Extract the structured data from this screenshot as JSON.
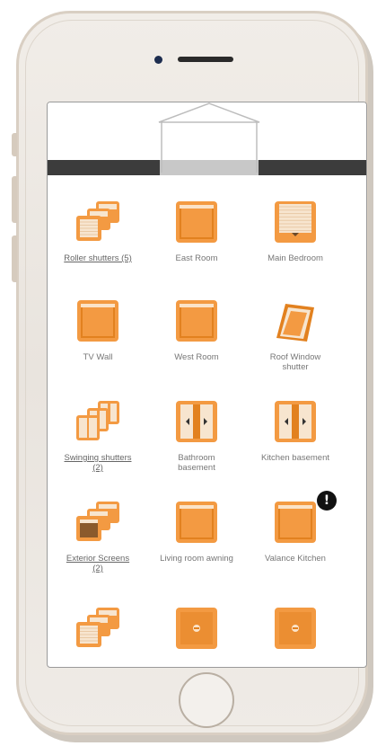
{
  "devices": [
    {
      "label": "Roller shutters (5)",
      "group": true,
      "icon": "stack-shutter-icon",
      "warning": false
    },
    {
      "label": "East Room",
      "group": false,
      "icon": "window-shutter-icon",
      "warning": false
    },
    {
      "label": "Main Bedroom",
      "group": false,
      "icon": "striped-shutter-icon",
      "warning": false
    },
    {
      "label": "TV Wall",
      "group": false,
      "icon": "window-shutter-icon",
      "warning": false
    },
    {
      "label": "West Room",
      "group": false,
      "icon": "window-shutter-icon",
      "warning": false
    },
    {
      "label": "Roof Window shutter",
      "group": false,
      "icon": "roof-window-icon",
      "warning": false
    },
    {
      "label": "Swinging shutters (2)",
      "group": true,
      "icon": "stack-swinging-icon",
      "warning": false
    },
    {
      "label": "Bathroom basement",
      "group": false,
      "icon": "swinging-shutter-icon",
      "warning": false
    },
    {
      "label": "Kitchen basement",
      "group": false,
      "icon": "swinging-shutter-icon",
      "warning": false
    },
    {
      "label": "Exterior Screens (2)",
      "group": true,
      "icon": "stack-screen-icon",
      "warning": false
    },
    {
      "label": "Living room awning",
      "group": false,
      "icon": "window-shutter-icon",
      "warning": false
    },
    {
      "label": "Valance Kitchen",
      "group": false,
      "icon": "window-shutter-icon",
      "warning": true
    },
    {
      "label": "",
      "group": true,
      "icon": "stack-shutter-icon",
      "warning": false
    },
    {
      "label": "",
      "group": false,
      "icon": "socket-device-icon",
      "warning": false
    },
    {
      "label": "",
      "group": false,
      "icon": "socket-device-icon",
      "warning": false
    }
  ],
  "colors": {
    "accent": "#f39a42",
    "accent_dark": "#e2811f",
    "header_bar": "#3c3c3c"
  }
}
